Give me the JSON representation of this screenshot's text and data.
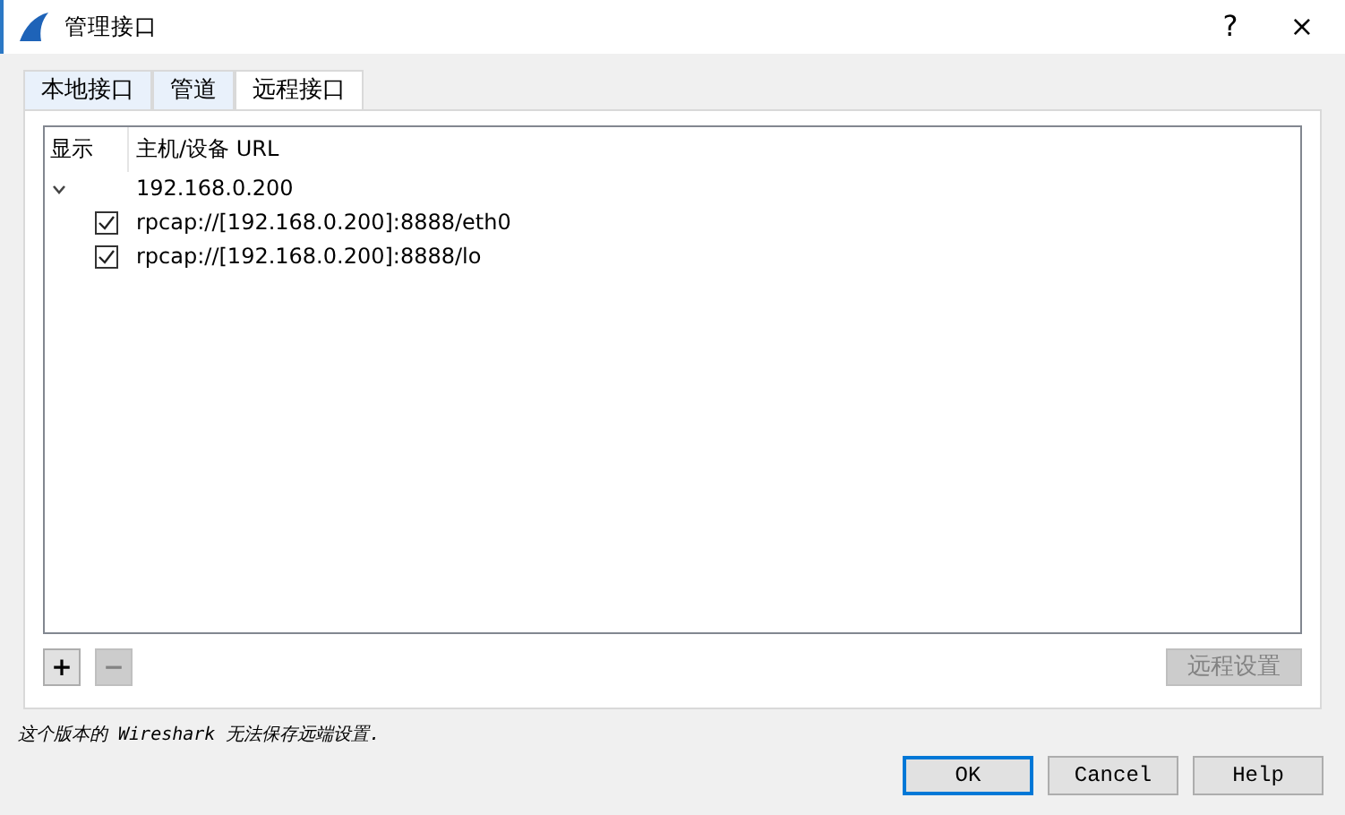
{
  "window": {
    "title": "管理接口",
    "help": "?",
    "close": "×"
  },
  "tabs": [
    {
      "label": "本地接口",
      "selected": false
    },
    {
      "label": "管道",
      "selected": false
    },
    {
      "label": "远程接口",
      "selected": true
    }
  ],
  "tree": {
    "columns": [
      "显示",
      "主机/设备 URL"
    ],
    "rows": [
      {
        "label": "192.168.0.200",
        "expanded": true,
        "children": [
          {
            "label": "rpcap://[192.168.0.200]:8888/eth0",
            "checked": true
          },
          {
            "label": "rpcap://[192.168.0.200]:8888/lo",
            "checked": true
          }
        ]
      }
    ]
  },
  "tools": [
    {
      "label": "+",
      "disabled": false
    },
    {
      "label": "−",
      "disabled": true
    }
  ],
  "remote_settings": {
    "label": "远程设置",
    "disabled": true
  },
  "note": "这个版本的 Wireshark 无法保存远端设置.",
  "buttons": [
    {
      "label": "OK",
      "default": true
    },
    {
      "label": "Cancel",
      "default": false
    },
    {
      "label": "Help",
      "default": false
    }
  ]
}
